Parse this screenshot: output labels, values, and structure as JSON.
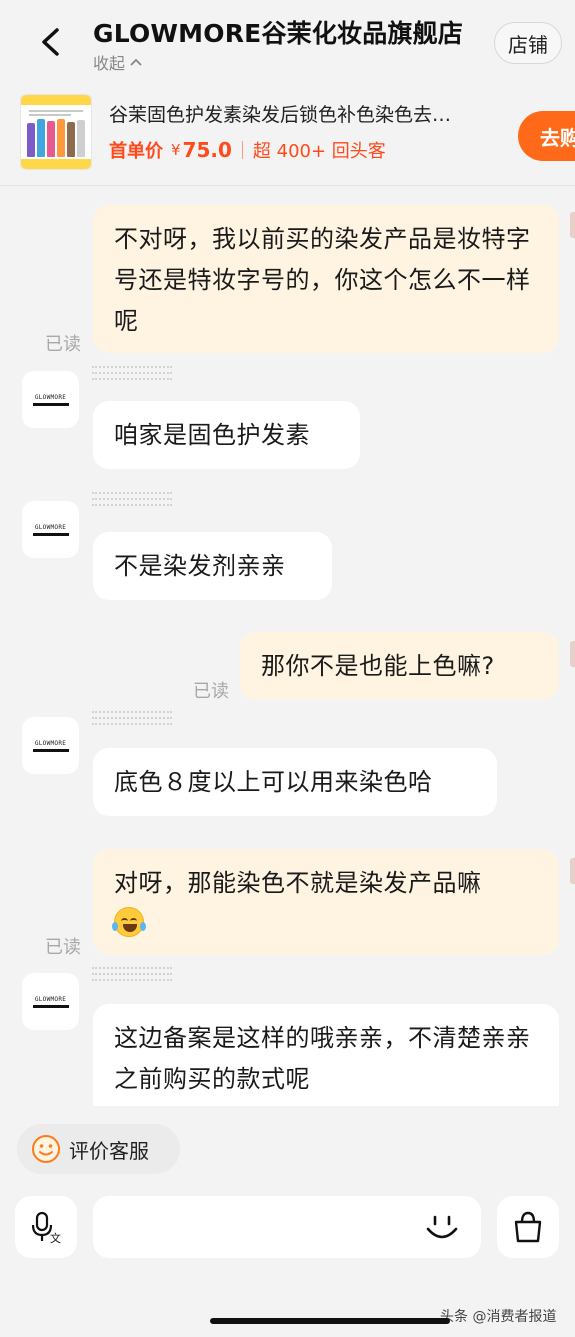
{
  "header": {
    "store_name": "GLOWMORE谷茉化妆品旗舰店",
    "collapse_label": "收起",
    "shop_button": "店铺"
  },
  "product": {
    "title": "谷茉固色护发素染发后锁色补色染色去…",
    "first_order_label": "首单价",
    "currency": "¥",
    "price": "75.0",
    "repeat_customers": "超 400+ 回头客",
    "go_button": "去购"
  },
  "messages": [
    {
      "from": "me",
      "text": "不对呀，我以前买的染发产品是妆特字号还是特妆字号的，你这个怎么不一样呢",
      "read": "已读"
    },
    {
      "from": "them",
      "text": "咱家是固色护发素"
    },
    {
      "from": "them",
      "text": "不是染发剂亲亲"
    },
    {
      "from": "me",
      "text": "那你不是也能上色嘛?",
      "read": "已读"
    },
    {
      "from": "them",
      "text": "底色８度以上可以用来染色哈"
    },
    {
      "from": "me",
      "text": "对呀，那能染色不就是染发产品嘛",
      "read": "已读"
    },
    {
      "from": "them",
      "text": "这边备案是这样的哦亲亲，不清楚亲亲之前购买的款式呢"
    }
  ],
  "avatar_logo": "GLOWMORE",
  "bottom": {
    "rate_service": "评价客服",
    "input_value": "",
    "input_placeholder": ""
  },
  "icons": {
    "back": "chevron-left-icon",
    "collapse": "chevron-up-icon",
    "rate": "smile-icon",
    "voice": "voice-text-icon",
    "emoji": "emoji-face-icon",
    "cart": "shopping-bag-icon",
    "emoji_inline": "laughing-tears-emoji"
  },
  "colors": {
    "accent": "#ff6a1a",
    "price": "#ff4a1c",
    "my_bubble": "#fff4e2",
    "their_bubble": "#ffffff",
    "background": "#f3f3f3"
  },
  "watermark": "头条 @消费者报道"
}
